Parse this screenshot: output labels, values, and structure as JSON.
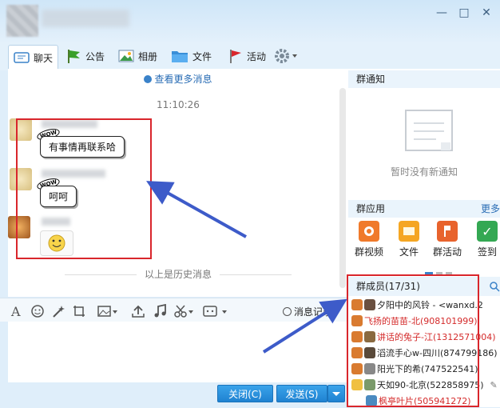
{
  "window": {
    "minimize_glyph": "—",
    "maximize_glyph": "□",
    "close_glyph": "✕"
  },
  "tabs": [
    {
      "label": "聊天",
      "icon": "chat-icon"
    },
    {
      "label": "公告",
      "icon": "flag-icon"
    },
    {
      "label": "相册",
      "icon": "photo-icon"
    },
    {
      "label": "文件",
      "icon": "folder-icon"
    },
    {
      "label": "活动",
      "icon": "red-flag-icon"
    }
  ],
  "chat": {
    "more_messages": "查看更多消息",
    "timestamp": "11:10:26",
    "messages": [
      {
        "text": "有事情再联系哈",
        "badge": "WOW"
      },
      {
        "text": "呵呵",
        "badge": "WOW"
      }
    ],
    "history_divider": "以上是历史消息"
  },
  "input_toolbar": {
    "history_label": "消息记录"
  },
  "actions": {
    "close_label": "关闭(C)",
    "send_label": "发送(S)"
  },
  "sidebar": {
    "notice_title": "群通知",
    "notice_empty": "暂时没有新通知",
    "apps_title": "群应用",
    "apps_more": "更多",
    "apps": [
      {
        "label": "群视频",
        "color": "#f07a2b"
      },
      {
        "label": "文件",
        "color": "#f5a623"
      },
      {
        "label": "群活动",
        "color": "#e8632d"
      },
      {
        "label": "签到",
        "color": "#34a853"
      }
    ],
    "members_title": "群成员(17/31)",
    "members": [
      {
        "name": "夕阳中的风铃 - <wanxd.2",
        "color": "#222222"
      },
      {
        "name": "飞扬的苗苗-北(908101999)",
        "color": "#d42a2a"
      },
      {
        "name": "讲话的兔子-江(1312571004)",
        "color": "#d42a2a"
      },
      {
        "name": "滔流手心w-四川(874799186)",
        "color": "#222222"
      },
      {
        "name": "阳光下的希(747522541)",
        "color": "#222222"
      },
      {
        "name": "天如90-北京(522858975)",
        "color": "#222222"
      },
      {
        "name": "枫亭叶片(505941272)",
        "color": "#d42a2a"
      }
    ]
  },
  "colors": {
    "accent": "#1f82d1",
    "annotation": "#d9262c",
    "arrow": "#3d5bc9"
  }
}
